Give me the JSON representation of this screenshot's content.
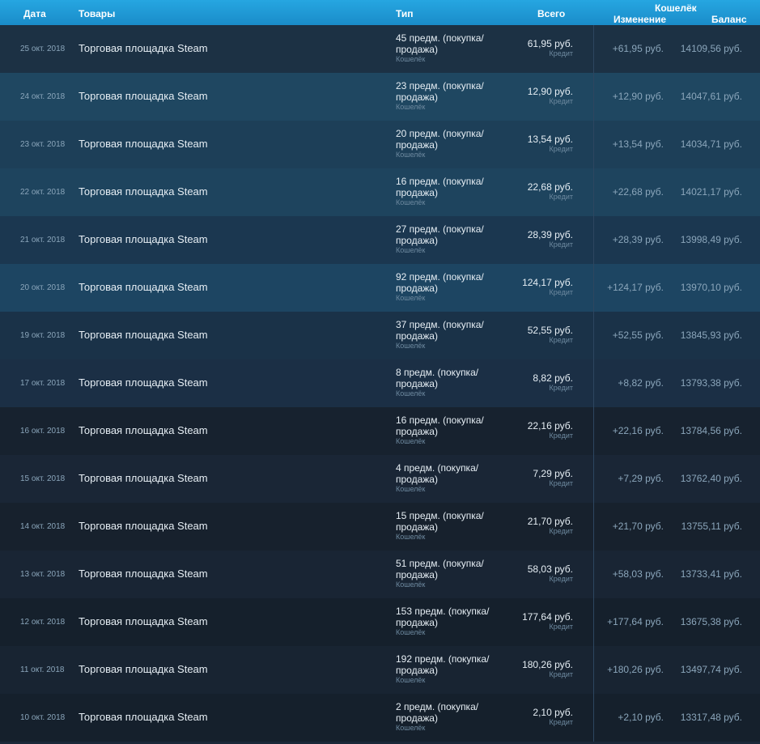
{
  "header": {
    "date": "Дата",
    "items": "Товары",
    "type": "Тип",
    "total": "Всего",
    "wallet": "Кошелёк",
    "change": "Изменение",
    "balance": "Баланс"
  },
  "colors": {
    "header_bg": "#1e9bd7",
    "page_bg": "#1b2838"
  },
  "rows": [
    {
      "date": "25 окт. 2018",
      "items": "Торговая площадка Steam",
      "type": "45 предм. (покупка/продажа)",
      "type_sub": "Кошелёк",
      "total": "61,95 руб.",
      "total_sub": "Кредит",
      "change": "+61,95 руб.",
      "balance": "14109,56 руб."
    },
    {
      "date": "24 окт. 2018",
      "items": "Торговая площадка Steam",
      "type": "23 предм. (покупка/продажа)",
      "type_sub": "Кошелёк",
      "total": "12,90 руб.",
      "total_sub": "Кредит",
      "change": "+12,90 руб.",
      "balance": "14047,61 руб."
    },
    {
      "date": "23 окт. 2018",
      "items": "Торговая площадка Steam",
      "type": "20 предм. (покупка/продажа)",
      "type_sub": "Кошелёк",
      "total": "13,54 руб.",
      "total_sub": "Кредит",
      "change": "+13,54 руб.",
      "balance": "14034,71 руб."
    },
    {
      "date": "22 окт. 2018",
      "items": "Торговая площадка Steam",
      "type": "16 предм. (покупка/продажа)",
      "type_sub": "Кошелёк",
      "total": "22,68 руб.",
      "total_sub": "Кредит",
      "change": "+22,68 руб.",
      "balance": "14021,17 руб."
    },
    {
      "date": "21 окт. 2018",
      "items": "Торговая площадка Steam",
      "type": "27 предм. (покупка/продажа)",
      "type_sub": "Кошелёк",
      "total": "28,39 руб.",
      "total_sub": "Кредит",
      "change": "+28,39 руб.",
      "balance": "13998,49 руб."
    },
    {
      "date": "20 окт. 2018",
      "items": "Торговая площадка Steam",
      "type": "92 предм. (покупка/продажа)",
      "type_sub": "Кошелёк",
      "total": "124,17 руб.",
      "total_sub": "Кредит",
      "change": "+124,17 руб.",
      "balance": "13970,10 руб."
    },
    {
      "date": "19 окт. 2018",
      "items": "Торговая площадка Steam",
      "type": "37 предм. (покупка/продажа)",
      "type_sub": "Кошелёк",
      "total": "52,55 руб.",
      "total_sub": "Кредит",
      "change": "+52,55 руб.",
      "balance": "13845,93 руб."
    },
    {
      "date": "17 окт. 2018",
      "items": "Торговая площадка Steam",
      "type": "8 предм. (покупка/продажа)",
      "type_sub": "Кошелёк",
      "total": "8,82 руб.",
      "total_sub": "Кредит",
      "change": "+8,82 руб.",
      "balance": "13793,38 руб."
    },
    {
      "date": "16 окт. 2018",
      "items": "Торговая площадка Steam",
      "type": "16 предм. (покупка/продажа)",
      "type_sub": "Кошелёк",
      "total": "22,16 руб.",
      "total_sub": "Кредит",
      "change": "+22,16 руб.",
      "balance": "13784,56 руб."
    },
    {
      "date": "15 окт. 2018",
      "items": "Торговая площадка Steam",
      "type": "4 предм. (покупка/продажа)",
      "type_sub": "Кошелёк",
      "total": "7,29 руб.",
      "total_sub": "Кредит",
      "change": "+7,29 руб.",
      "balance": "13762,40 руб."
    },
    {
      "date": "14 окт. 2018",
      "items": "Торговая площадка Steam",
      "type": "15 предм. (покупка/продажа)",
      "type_sub": "Кошелёк",
      "total": "21,70 руб.",
      "total_sub": "Кредит",
      "change": "+21,70 руб.",
      "balance": "13755,11 руб."
    },
    {
      "date": "13 окт. 2018",
      "items": "Торговая площадка Steam",
      "type": "51 предм. (покупка/продажа)",
      "type_sub": "Кошелёк",
      "total": "58,03 руб.",
      "total_sub": "Кредит",
      "change": "+58,03 руб.",
      "balance": "13733,41 руб."
    },
    {
      "date": "12 окт. 2018",
      "items": "Торговая площадка Steam",
      "type": "153 предм. (покупка/продажа)",
      "type_sub": "Кошелёк",
      "total": "177,64 руб.",
      "total_sub": "Кредит",
      "change": "+177,64 руб.",
      "balance": "13675,38 руб."
    },
    {
      "date": "11 окт. 2018",
      "items": "Торговая площадка Steam",
      "type": "192 предм. (покупка/продажа)",
      "type_sub": "Кошелёк",
      "total": "180,26 руб.",
      "total_sub": "Кредит",
      "change": "+180,26 руб.",
      "balance": "13497,74 руб."
    },
    {
      "date": "10 окт. 2018",
      "items": "Торговая площадка Steam",
      "type": "2 предм. (покупка/продажа)",
      "type_sub": "Кошелёк",
      "total": "2,10 руб.",
      "total_sub": "Кредит",
      "change": "+2,10 руб.",
      "balance": "13317,48 руб."
    }
  ]
}
